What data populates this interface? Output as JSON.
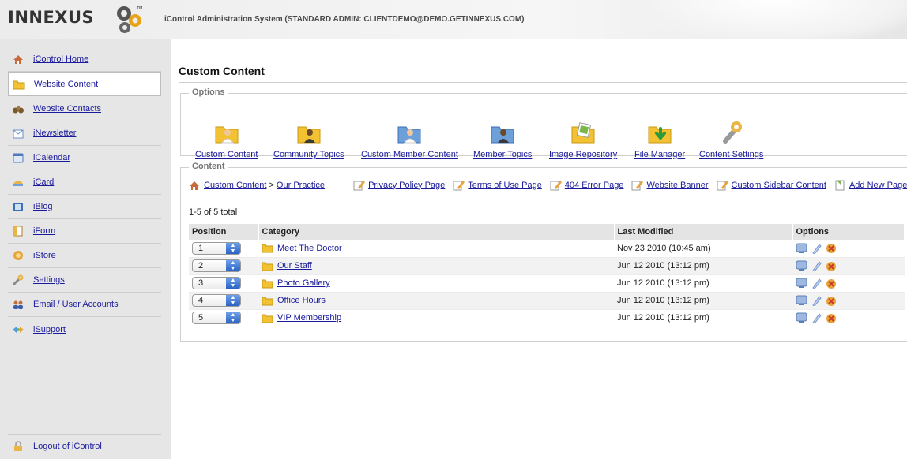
{
  "header": {
    "logo_text": "INNEXUS",
    "system_title": "iControl Administration System (STANDARD ADMIN: CLIENTDEMO@DEMO.GETINNEXUS.COM)"
  },
  "sidebar": {
    "items": [
      {
        "label": "iControl Home",
        "icon": "home-icon"
      },
      {
        "label": "Website Content",
        "icon": "folder-icon"
      },
      {
        "label": "Website Contacts",
        "icon": "binoculars-icon"
      },
      {
        "label": "iNewsletter",
        "icon": "newsletter-icon"
      },
      {
        "label": "iCalendar",
        "icon": "calendar-icon"
      },
      {
        "label": "iCard",
        "icon": "card-icon"
      },
      {
        "label": "iBlog",
        "icon": "blog-icon"
      },
      {
        "label": "iForm",
        "icon": "form-icon"
      },
      {
        "label": "iStore",
        "icon": "store-icon"
      },
      {
        "label": "Settings",
        "icon": "wrench-icon"
      },
      {
        "label": "Email / User Accounts",
        "icon": "users-icon"
      },
      {
        "label": "iSupport",
        "icon": "support-icon"
      }
    ],
    "active_item": "Website Content",
    "logout_label": "Logout of iControl"
  },
  "main": {
    "title": "Custom Content",
    "options_legend": "Options",
    "options": [
      {
        "label": "Custom Content",
        "icon": "folder-person-icon"
      },
      {
        "label": "Community Topics",
        "icon": "folder-person-dark-icon"
      },
      {
        "label": "Custom Member Content",
        "icon": "blue-folder-person-icon"
      },
      {
        "label": "Member Topics",
        "icon": "blue-folder-person-dark-icon"
      },
      {
        "label": "Image Repository",
        "icon": "folder-image-icon"
      },
      {
        "label": "File Manager",
        "icon": "folder-download-icon"
      },
      {
        "label": "Content Settings",
        "icon": "wrench-icon"
      }
    ],
    "content_legend": "Content",
    "breadcrumb": {
      "root": "Custom Content",
      "separator": ">",
      "current": "Our Practice"
    },
    "quick_links": [
      "Privacy Policy Page",
      "Terms of Use Page",
      "404 Error Page",
      "Website Banner",
      "Custom Sidebar Content",
      "Add New Page"
    ],
    "count_text": "1-5 of 5 total",
    "table": {
      "headers": [
        "Position",
        "Category",
        "Last Modified",
        "Options"
      ],
      "rows": [
        {
          "position": "1",
          "category": "Meet The Doctor",
          "modified": "Nov 23 2010 (10:45 am)"
        },
        {
          "position": "2",
          "category": "Our Staff",
          "modified": "Jun 12 2010 (13:12 pm)"
        },
        {
          "position": "3",
          "category": "Photo Gallery",
          "modified": "Jun 12 2010 (13:12 pm)"
        },
        {
          "position": "4",
          "category": "Office Hours",
          "modified": "Jun 12 2010 (13:12 pm)"
        },
        {
          "position": "5",
          "category": "VIP Membership",
          "modified": "Jun 12 2010 (13:12 pm)"
        }
      ]
    }
  },
  "colors": {
    "link": "#1a1a9c",
    "sidebar_bg": "#e6e6e6",
    "folder": "#f3c233"
  }
}
